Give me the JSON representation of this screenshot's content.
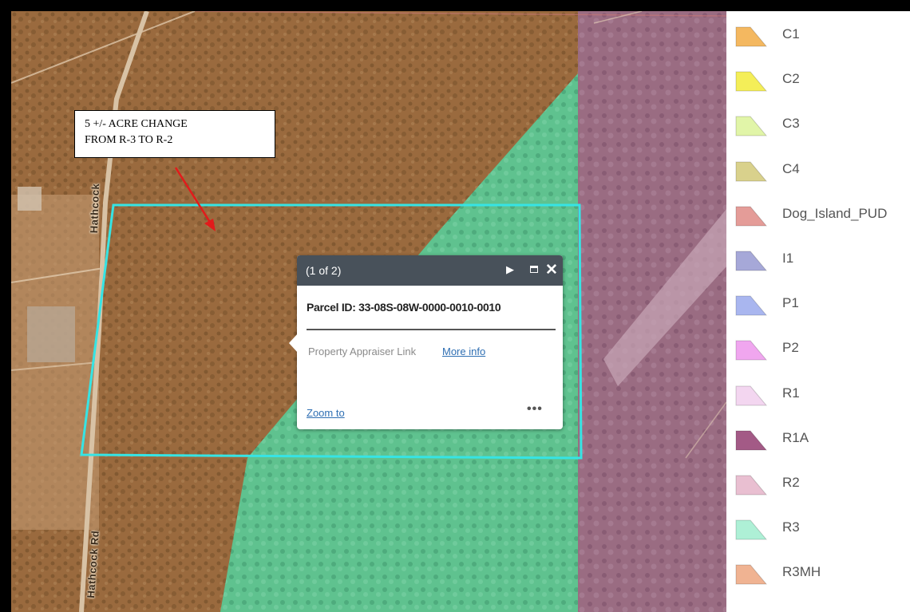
{
  "map": {
    "roads": [
      "Hathcock",
      "Hathcock Rd"
    ],
    "colors": {
      "r3_zone": "#6fcf97",
      "r1a_zone": "#9b6b8a",
      "parcel_outline": "#2ee6e6",
      "arrow": "#e11a1a"
    }
  },
  "annotation": {
    "line1": "5 +/- ACRE CHANGE",
    "line2": "FROM R-3 TO R-2"
  },
  "popup": {
    "count": "(1 of 2)",
    "next_icon": "▶",
    "close_icon": "✕",
    "title": "Parcel ID: 33-08S-08W-0000-0010-0010",
    "property_label": "Property Appraiser Link",
    "property_link": "More info",
    "zoom": "Zoom to",
    "more": "•••"
  },
  "legend": {
    "items": [
      {
        "label": "C1",
        "color": "#f4b860"
      },
      {
        "label": "C2",
        "color": "#f4ee58"
      },
      {
        "label": "C3",
        "color": "#e1f5a8"
      },
      {
        "label": "C4",
        "color": "#d9d18c"
      },
      {
        "label": "Dog_Island_PUD",
        "color": "#e49c98"
      },
      {
        "label": "I1",
        "color": "#a6a8d8"
      },
      {
        "label": "P1",
        "color": "#a9b6ef"
      },
      {
        "label": "P2",
        "color": "#f0a6ef"
      },
      {
        "label": "R1",
        "color": "#f3d6f0"
      },
      {
        "label": "R1A",
        "color": "#a35a86"
      },
      {
        "label": "R2",
        "color": "#e9bfd1"
      },
      {
        "label": "R3",
        "color": "#aef0d6"
      },
      {
        "label": "R3MH",
        "color": "#f0b392"
      }
    ]
  }
}
